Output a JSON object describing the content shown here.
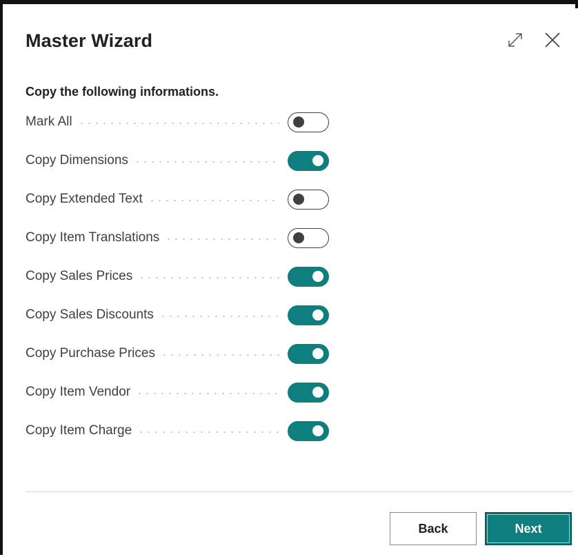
{
  "dialog": {
    "title": "Master Wizard",
    "expand_icon": "expand-diagonal-icon",
    "close_icon": "close-icon"
  },
  "section": {
    "heading": "Copy the following informations."
  },
  "options": [
    {
      "label": "Mark All",
      "checked": false
    },
    {
      "label": "Copy Dimensions",
      "checked": true
    },
    {
      "label": "Copy Extended Text",
      "checked": false
    },
    {
      "label": "Copy Item Translations",
      "checked": false
    },
    {
      "label": "Copy Sales Prices",
      "checked": true
    },
    {
      "label": "Copy Sales Discounts",
      "checked": true
    },
    {
      "label": "Copy Purchase Prices",
      "checked": true
    },
    {
      "label": "Copy Item Vendor",
      "checked": true
    },
    {
      "label": "Copy Item Charge",
      "checked": true
    }
  ],
  "footer": {
    "back_label": "Back",
    "next_label": "Next"
  },
  "colors": {
    "accent": "#0f7e7e",
    "toggle_off": "#404040"
  }
}
